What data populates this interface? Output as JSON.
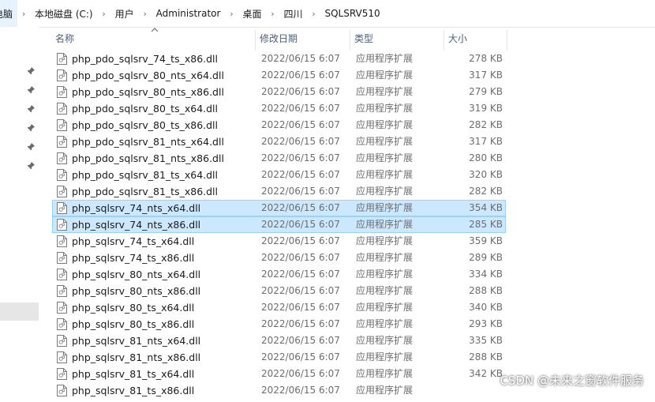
{
  "breadcrumb": {
    "items": [
      "电脑",
      "本地磁盘 (C:)",
      "用户",
      "Administrator",
      "桌面",
      "四川",
      "SQLSRV510"
    ]
  },
  "columns": {
    "name": "名称",
    "date": "修改日期",
    "type": "类型",
    "size": "大小"
  },
  "files": [
    {
      "name": "php_pdo_sqlsrv_74_ts_x86.dll",
      "date": "2022/06/15 6:07",
      "type": "应用程序扩展",
      "size": "278 KB",
      "selected": false
    },
    {
      "name": "php_pdo_sqlsrv_80_nts_x64.dll",
      "date": "2022/06/15 6:07",
      "type": "应用程序扩展",
      "size": "317 KB",
      "selected": false
    },
    {
      "name": "php_pdo_sqlsrv_80_nts_x86.dll",
      "date": "2022/06/15 6:07",
      "type": "应用程序扩展",
      "size": "279 KB",
      "selected": false
    },
    {
      "name": "php_pdo_sqlsrv_80_ts_x64.dll",
      "date": "2022/06/15 6:07",
      "type": "应用程序扩展",
      "size": "319 KB",
      "selected": false
    },
    {
      "name": "php_pdo_sqlsrv_80_ts_x86.dll",
      "date": "2022/06/15 6:07",
      "type": "应用程序扩展",
      "size": "282 KB",
      "selected": false
    },
    {
      "name": "php_pdo_sqlsrv_81_nts_x64.dll",
      "date": "2022/06/15 6:07",
      "type": "应用程序扩展",
      "size": "317 KB",
      "selected": false
    },
    {
      "name": "php_pdo_sqlsrv_81_nts_x86.dll",
      "date": "2022/06/15 6:07",
      "type": "应用程序扩展",
      "size": "280 KB",
      "selected": false
    },
    {
      "name": "php_pdo_sqlsrv_81_ts_x64.dll",
      "date": "2022/06/15 6:07",
      "type": "应用程序扩展",
      "size": "320 KB",
      "selected": false
    },
    {
      "name": "php_pdo_sqlsrv_81_ts_x86.dll",
      "date": "2022/06/15 6:07",
      "type": "应用程序扩展",
      "size": "282 KB",
      "selected": false
    },
    {
      "name": "php_sqlsrv_74_nts_x64.dll",
      "date": "2022/06/15 6:07",
      "type": "应用程序扩展",
      "size": "354 KB",
      "selected": true
    },
    {
      "name": "php_sqlsrv_74_nts_x86.dll",
      "date": "2022/06/15 6:07",
      "type": "应用程序扩展",
      "size": "285 KB",
      "selected": true
    },
    {
      "name": "php_sqlsrv_74_ts_x64.dll",
      "date": "2022/06/15 6:07",
      "type": "应用程序扩展",
      "size": "359 KB",
      "selected": false
    },
    {
      "name": "php_sqlsrv_74_ts_x86.dll",
      "date": "2022/06/15 6:07",
      "type": "应用程序扩展",
      "size": "289 KB",
      "selected": false
    },
    {
      "name": "php_sqlsrv_80_nts_x64.dll",
      "date": "2022/06/15 6:07",
      "type": "应用程序扩展",
      "size": "334 KB",
      "selected": false
    },
    {
      "name": "php_sqlsrv_80_nts_x86.dll",
      "date": "2022/06/15 6:07",
      "type": "应用程序扩展",
      "size": "288 KB",
      "selected": false
    },
    {
      "name": "php_sqlsrv_80_ts_x64.dll",
      "date": "2022/06/15 6:07",
      "type": "应用程序扩展",
      "size": "340 KB",
      "selected": false
    },
    {
      "name": "php_sqlsrv_80_ts_x86.dll",
      "date": "2022/06/15 6:07",
      "type": "应用程序扩展",
      "size": "293 KB",
      "selected": false
    },
    {
      "name": "php_sqlsrv_81_nts_x64.dll",
      "date": "2022/06/15 6:07",
      "type": "应用程序扩展",
      "size": "335 KB",
      "selected": false
    },
    {
      "name": "php_sqlsrv_81_nts_x86.dll",
      "date": "2022/06/15 6:07",
      "type": "应用程序扩展",
      "size": "288 KB",
      "selected": false
    },
    {
      "name": "php_sqlsrv_81_ts_x64.dll",
      "date": "2022/06/15 6:07",
      "type": "应用程序扩展",
      "size": "342 KB",
      "selected": false
    },
    {
      "name": "php_sqlsrv_81_ts_x86.dll",
      "date": "2022/06/15 6:07",
      "type": "应用程序扩展",
      "size": "",
      "selected": false
    }
  ],
  "watermark": "CSDN @未来之窗软件服务",
  "colors": {
    "selection_bg": "#cce8ff",
    "selection_border": "#99d1ff",
    "header_text": "#4c607a"
  }
}
